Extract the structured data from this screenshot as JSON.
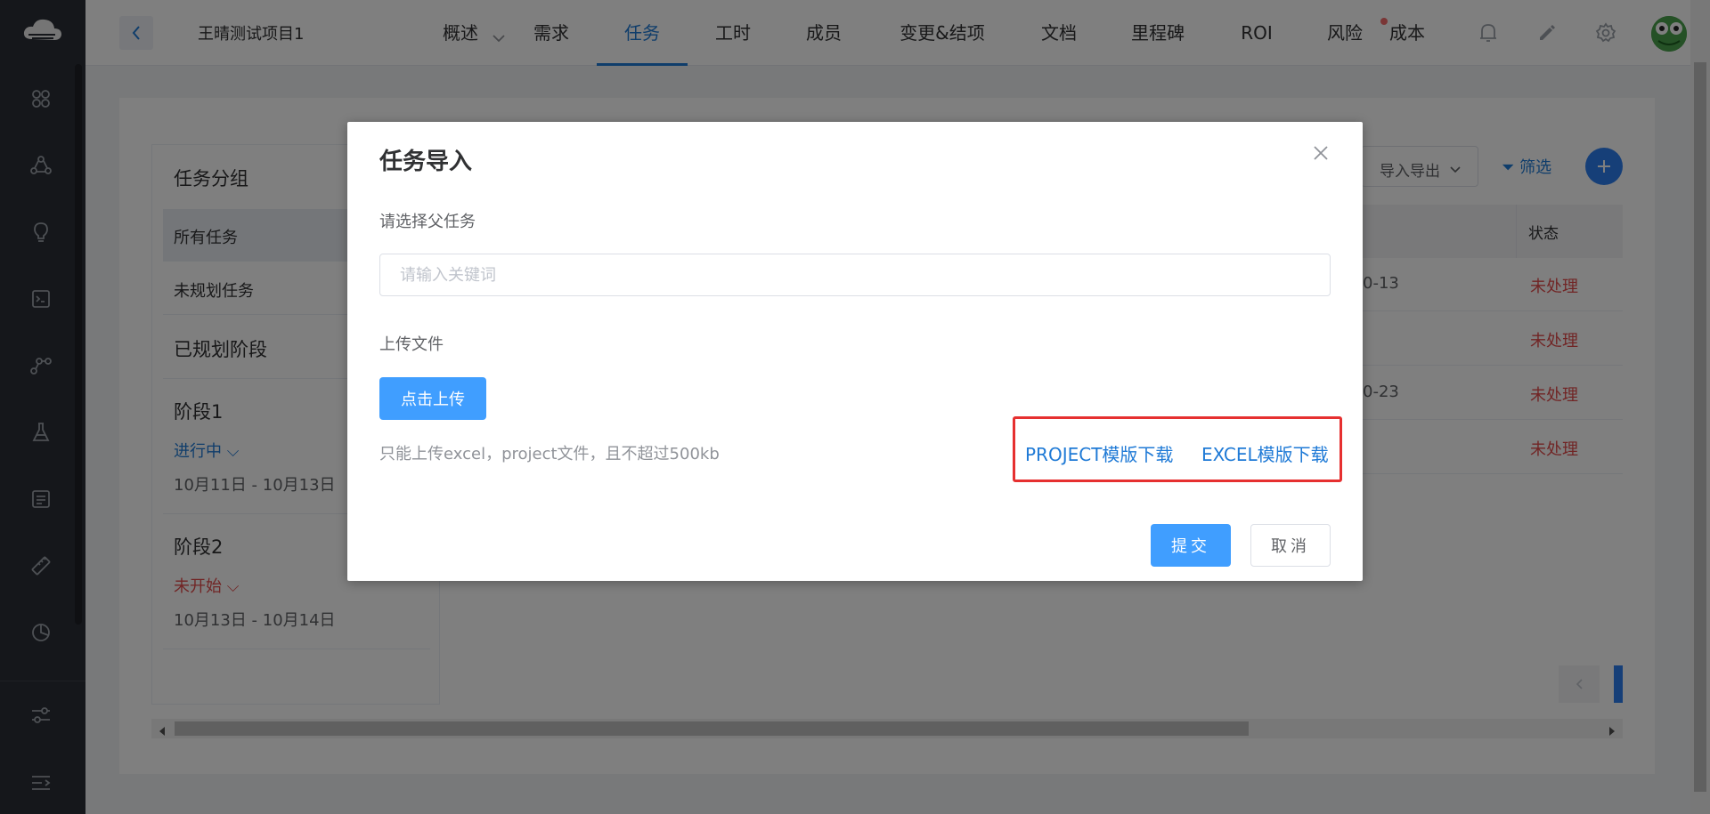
{
  "topnav": {
    "project": "王晴测试项目1",
    "tabs": [
      {
        "label": "概述",
        "active": false
      },
      {
        "label": "需求",
        "active": false
      },
      {
        "label": "任务",
        "active": true
      },
      {
        "label": "工时",
        "active": false
      },
      {
        "label": "成员",
        "active": false
      },
      {
        "label": "变更&结项",
        "active": false
      },
      {
        "label": "文档",
        "active": false
      },
      {
        "label": "里程碑",
        "active": false
      },
      {
        "label": "ROI",
        "active": false
      },
      {
        "label": "风险",
        "active": false
      },
      {
        "label": "成本",
        "active": false
      }
    ]
  },
  "sidebar_icons": [
    "cloud-logo-icon",
    "apps-icon",
    "share-icon",
    "bulb-icon",
    "terminal-icon",
    "branch-icon",
    "flask-icon",
    "list-icon",
    "ruler-icon",
    "pie-chart-icon",
    "sliders-icon",
    "menu-fold-icon"
  ],
  "groups": {
    "header": "任务分组",
    "all_tasks": "所有任务",
    "unplanned": "未规划任务",
    "planned_header": "已规划阶段",
    "stages": [
      {
        "name": "阶段1",
        "status": "进行中",
        "dates": "10月11日 - 10月13日"
      },
      {
        "name": "阶段2",
        "status": "未开始",
        "dates": "10月13日 - 10月14日"
      }
    ]
  },
  "table": {
    "status_header": "状态",
    "rows": [
      {
        "date": "0-13",
        "status": "未处理"
      },
      {
        "date": "",
        "status": "未处理"
      },
      {
        "date": "0-23",
        "status": "未处理"
      },
      {
        "date": "",
        "status": "未处理"
      }
    ]
  },
  "toolbar": {
    "import_export": "导入导出",
    "filter": "筛选"
  },
  "dialog": {
    "title": "任务导入",
    "parent_label": "请选择父任务",
    "search_placeholder": "请输入关键词",
    "upload_label": "上传文件",
    "upload_button": "点击上传",
    "tip": "只能上传excel，project文件，且不超过500kb",
    "project_template": "PROJECT模版下载",
    "excel_template": "EXCEL模版下载",
    "submit": "提交",
    "cancel": "取消"
  },
  "colors": {
    "accent": "#409eff",
    "link": "#1f7ad6",
    "danger": "#e24a4a",
    "highlight_box": "#e63030",
    "sidebar": "#2b2f36"
  }
}
